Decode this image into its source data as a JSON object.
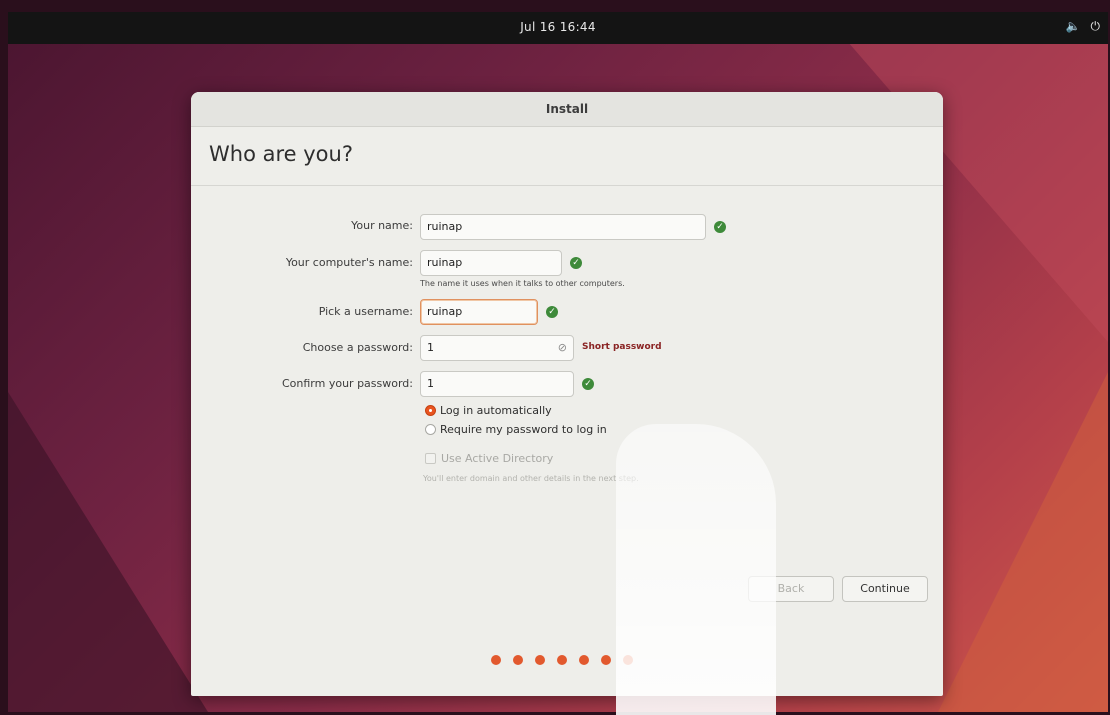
{
  "topbar": {
    "clock": "Jul 16  16:44",
    "volume_icon": "volume-icon",
    "power_icon": "power-icon"
  },
  "window": {
    "title": "Install",
    "heading": "Who are you?"
  },
  "form": {
    "name_label": "Your name:",
    "name_value": "ruinap",
    "computer_label": "Your computer's name:",
    "computer_value": "ruinap",
    "computer_hint": "The name it uses when it talks to other computers.",
    "username_label": "Pick a username:",
    "username_value": "ruinap",
    "password_label": "Choose a password:",
    "password_value": "1",
    "password_warning": "Short password",
    "confirm_label": "Confirm your password:",
    "confirm_value": "1",
    "login_auto_label": "Log in automatically",
    "login_password_label": "Require my password to log in",
    "login_option_selected": "Log in automatically",
    "active_directory_label": "Use Active Directory",
    "active_directory_note": "You'll enter domain and other details in the next step."
  },
  "buttons": {
    "back": "Back",
    "continue": "Continue"
  },
  "progress": {
    "steps_total": 7,
    "steps_shown": 7
  },
  "colors": {
    "accent": "#e95420",
    "check": "#3e8a3a",
    "warning": "#8a2323"
  }
}
